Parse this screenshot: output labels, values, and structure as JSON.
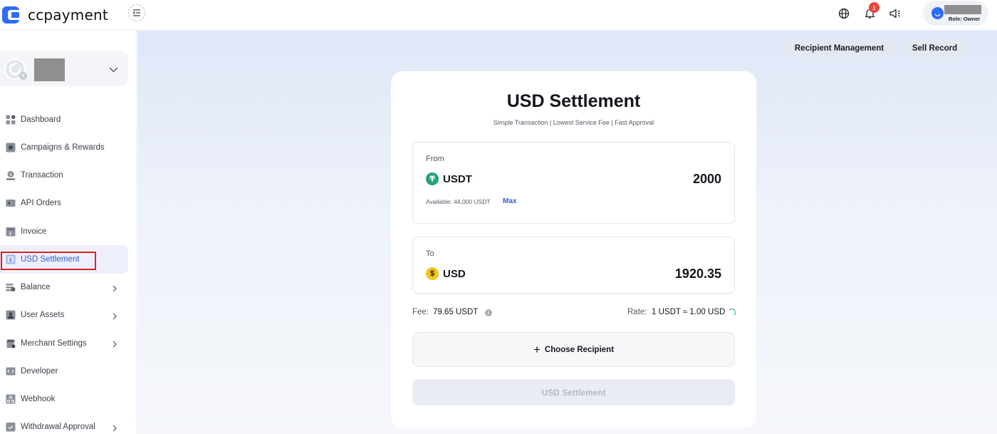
{
  "brand": {
    "name": "ccpayment"
  },
  "topbar": {
    "notification_count": "1",
    "user_role": "Role: Owner",
    "icons": [
      "globe-icon",
      "bell-icon",
      "megaphone-icon"
    ]
  },
  "sidebar": {
    "items": [
      {
        "label": "Dashboard",
        "icon": "dashboard-icon",
        "has_children": false
      },
      {
        "label": "Campaigns & Rewards",
        "icon": "star-icon",
        "has_children": false
      },
      {
        "label": "Transaction",
        "icon": "transaction-icon",
        "has_children": false
      },
      {
        "label": "API Orders",
        "icon": "api-orders-icon",
        "has_children": false
      },
      {
        "label": "Invoice",
        "icon": "invoice-icon",
        "has_children": false
      },
      {
        "label": "USD Settlement",
        "icon": "usd-settlement-icon",
        "has_children": false,
        "active": true
      },
      {
        "label": "Balance",
        "icon": "balance-icon",
        "has_children": true
      },
      {
        "label": "User Assets",
        "icon": "user-assets-icon",
        "has_children": true
      },
      {
        "label": "Merchant Settings",
        "icon": "merchant-settings-icon",
        "has_children": true
      },
      {
        "label": "Developer",
        "icon": "code-icon",
        "has_children": false
      },
      {
        "label": "Webhook",
        "icon": "webhook-icon",
        "has_children": false
      },
      {
        "label": "Withdrawal Approval",
        "icon": "withdrawal-icon",
        "has_children": true
      }
    ]
  },
  "header": {
    "recipient_management": "Recipient Management",
    "sell_record": "Sell Record"
  },
  "settlement": {
    "title": "USD Settlement",
    "subtitle": "Simple Transaction | Lowest Service Fee | Fast Approval",
    "from": {
      "label": "From",
      "coin": "USDT",
      "amount": "2000",
      "available": "Available: 44,000 USDT",
      "max": "Max"
    },
    "to": {
      "label": "To",
      "coin": "USD",
      "amount": "1920.35"
    },
    "fee_label": "Fee:",
    "fee_value": "79.65 USDT",
    "rate_label": "Rate:",
    "rate_value": "1 USDT ≈ 1.00 USD",
    "choose_recipient": "Choose Recipient",
    "submit": "USD Settlement"
  },
  "colors": {
    "accent": "#2f5bd8",
    "usdt": "#26a17b",
    "usd": "#f5c518",
    "highlight": "#e02020"
  }
}
